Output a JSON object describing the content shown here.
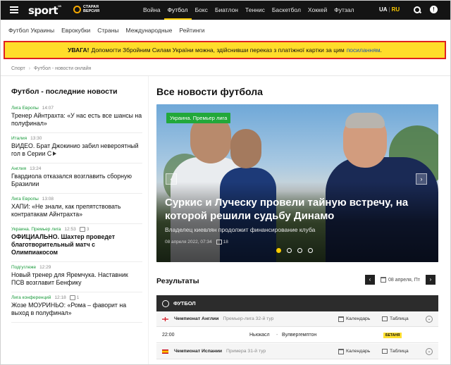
{
  "header": {
    "logo_text": "sport",
    "logo_suffix": "ua",
    "old_version": "СТАРАЯ ВЕРСИЯ",
    "nav": [
      {
        "label": "Война"
      },
      {
        "label": "Футбол",
        "active": true
      },
      {
        "label": "Бокс"
      },
      {
        "label": "Биатлон"
      },
      {
        "label": "Теннис"
      },
      {
        "label": "Баскетбол"
      },
      {
        "label": "Хоккей"
      },
      {
        "label": "Футзал"
      }
    ],
    "lang_ua": "UA",
    "lang_sep": "|",
    "lang_ru": "RU"
  },
  "subnav": [
    "Футбол Украины",
    "Еврокубки",
    "Страны",
    "Международные",
    "Рейтинги"
  ],
  "alert": {
    "lead": "УВАГА!",
    "text": "Допомогти Збройним Силам України можна, здійснивши переказ з платіжної картки за цим",
    "link": "посиланням",
    "tail": "."
  },
  "breadcrumbs": [
    "Спорт",
    "Футбол - новости онлайн"
  ],
  "left": {
    "title": "Футбол - последние новости",
    "news": [
      {
        "cat": "Лига Европы",
        "time": "14:07",
        "comments": "",
        "title": "Тренер Айнтрахта: «У нас есть все шансы на полуфинал»",
        "bold": false,
        "video": false
      },
      {
        "cat": "Италия",
        "time": "13:30",
        "comments": "",
        "title": "ВИДЕО. Брат Джокинио забил невероятный гол в Серии С",
        "bold": false,
        "video": true
      },
      {
        "cat": "Англия",
        "time": "13:24",
        "comments": "",
        "title": "Гвардиола отказался возглавить сборную Бразилии",
        "bold": false,
        "video": false
      },
      {
        "cat": "Лига Европы",
        "time": "13:08",
        "comments": "",
        "title": "ХАПИ: «Не знали, как препятствовать контратакам Айнтрахта»",
        "bold": false,
        "video": false
      },
      {
        "cat": "Украина. Премьер лига",
        "time": "12:53",
        "comments": "3",
        "title": "ОФИЦИАЛЬНО. Шахтер проведет благотворительный матч с Олимпиакосом",
        "bold": true,
        "video": false
      },
      {
        "cat": "Подгуглеже",
        "time": "12:29",
        "comments": "",
        "title": "Новый тренер для Яремчука. Наставник ПСВ возглавит Бенфику",
        "bold": false,
        "video": false
      },
      {
        "cat": "Лига конференций",
        "time": "12:18",
        "comments": "1",
        "title": "Жозе МОУРИНЬО: «Рома – фаворит на выход в полуфинал»",
        "bold": false,
        "video": false
      }
    ]
  },
  "right": {
    "title": "Все новости футбола",
    "hero": {
      "tag": "Украина. Премьер лига",
      "headline": "Суркис и Луческу провели тайную встречу, на которой решили судьбу Динамо",
      "subtitle": "Владелец киевлян продолжит финансирование клуба",
      "date": "08 апреля 2022, 07:34",
      "comments": "18",
      "prev": "‹",
      "next": "›",
      "slides_total": 4,
      "slide_active": 1
    },
    "results": {
      "title": "Результаты",
      "prev": "‹",
      "next": "›",
      "date": "08 апреля, Пт",
      "sport": "ФУТБОЛ",
      "leagues": [
        {
          "name": "Чемпионат Англии",
          "round": "Премьер-лига 32-й тур",
          "calendar": "Календарь",
          "table": "Таблица"
        },
        {
          "name": "Чемпионат Испании",
          "round": "Примера 31-й тур",
          "calendar": "Календарь",
          "table": "Таблица"
        }
      ],
      "match": {
        "time": "22:00",
        "home": "Ньюкасл",
        "score": "-",
        "away": "Вулвергемптон",
        "odds": "БЕТАНЯ"
      }
    }
  },
  "colors": {
    "accent": "#ffcc00",
    "alert_bg": "#ffdd2a",
    "alert_border": "#e02020",
    "green": "#22a83a",
    "dark": "#141414"
  }
}
